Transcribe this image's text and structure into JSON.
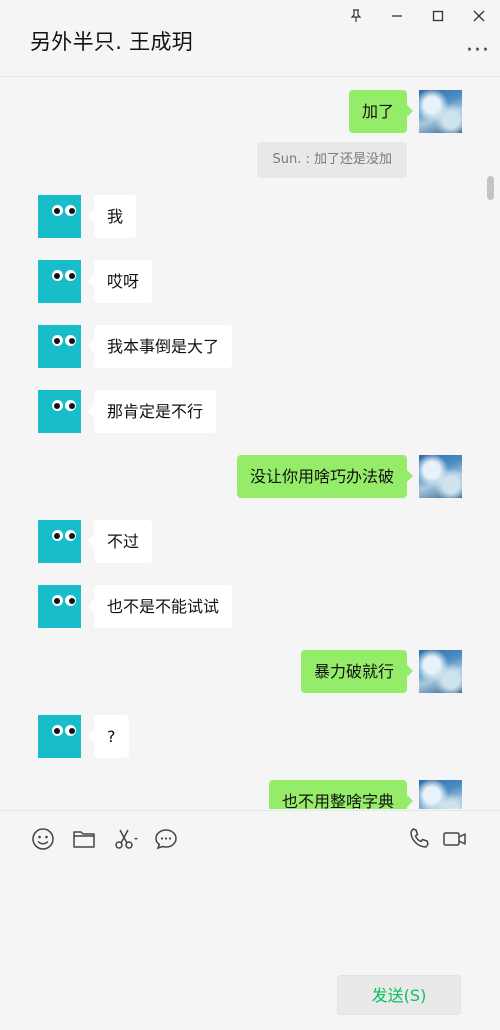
{
  "header": {
    "title": "另外半只. 王成玥",
    "more": "···",
    "pin_icon": "pin-icon",
    "minimize_icon": "minimize-icon",
    "maximize_icon": "maximize-icon",
    "close_icon": "close-icon"
  },
  "messages": [
    {
      "side": "right",
      "text": "加了"
    },
    {
      "side": "quote",
      "text": "Sun. : 加了还是没加"
    },
    {
      "side": "left",
      "text": "我"
    },
    {
      "side": "left",
      "text": "哎呀"
    },
    {
      "side": "left",
      "text": "我本事倒是大了"
    },
    {
      "side": "left",
      "text": "那肯定是不行"
    },
    {
      "side": "right",
      "text": "没让你用啥巧办法破"
    },
    {
      "side": "left",
      "text": "不过"
    },
    {
      "side": "left",
      "text": "也不是不能试试"
    },
    {
      "side": "right",
      "text": "暴力破就行"
    },
    {
      "side": "left",
      "text": "?"
    },
    {
      "side": "right",
      "text": "也不用整啥字典"
    }
  ],
  "toolbar": {
    "emoji_icon": "emoji-icon",
    "folder_icon": "folder-icon",
    "scissors_icon": "scissors-icon",
    "chat_icon": "chat-bubble-icon",
    "phone_icon": "phone-icon",
    "video_icon": "video-icon"
  },
  "composer": {
    "input_value": "",
    "send_label": "发送(S)"
  },
  "colors": {
    "my_bubble": "#95ec69",
    "their_bubble": "#ffffff",
    "bot_avatar": "#17bec9",
    "send_text": "#07c160",
    "background": "#f5f5f5"
  }
}
